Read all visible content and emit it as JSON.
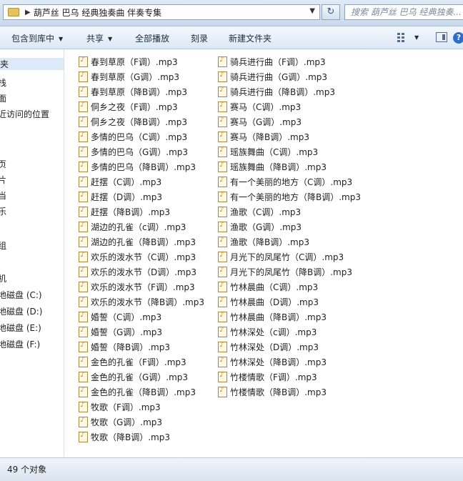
{
  "address": {
    "segments": [
      "葫芦丝 巴乌 经典独奏曲 伴奏专集"
    ],
    "search_placeholder": "搜索 葫芦丝 巴乌 经典独奏..."
  },
  "toolbar": {
    "include_library": "包含到库中",
    "share": "共享",
    "play_all": "全部播放",
    "burn": "刻录",
    "new_folder": "新建文件夹"
  },
  "nav": {
    "items": [
      "夹",
      "栈",
      "面",
      "近访问的位置",
      "",
      "页",
      "片",
      "当",
      "乐",
      "",
      "组",
      "",
      "机",
      "地磁盘 (C:)",
      "地磁盘 (D:)",
      "地磁盘 (E:)",
      "地磁盘 (F:)"
    ]
  },
  "files": {
    "col1": [
      "春到草原（F调）.mp3",
      "春到草原（G调）.mp3",
      "春到草原（降B调）.mp3",
      "侗乡之夜（F调）.mp3",
      "侗乡之夜（降B调）.mp3",
      "多情的巴乌（C调）.mp3",
      "多情的巴乌（G调）.mp3",
      "多情的巴乌（降B调）.mp3",
      "赶摆（C调）.mp3",
      "赶摆（D调）.mp3",
      "赶摆（降B调）.mp3",
      "湖边的孔雀（c调）.mp3",
      "湖边的孔雀（降B调）.mp3",
      "欢乐的泼水节（C调）.mp3",
      "欢乐的泼水节（D调）.mp3",
      "欢乐的泼水节（F调）.mp3",
      "欢乐的泼水节（降B调）.mp3",
      "婚誓（C调）.mp3",
      "婚誓（G调）.mp3",
      "婚誓（降B调）.mp3",
      "金色的孔雀（F调）.mp3",
      "金色的孔雀（G调）.mp3",
      "金色的孔雀（降B调）.mp3",
      "牧歌（F调）.mp3",
      "牧歌（G调）.mp3",
      "牧歌（降B调）.mp3"
    ],
    "col2": [
      "骑兵进行曲（F调）.mp3",
      "骑兵进行曲（G调）.mp3",
      "骑兵进行曲（降B调）.mp3",
      "赛马（C调）.mp3",
      "赛马（G调）.mp3",
      "赛马（降B调）.mp3",
      "瑶族舞曲（C调）.mp3",
      "瑶族舞曲（降B调）.mp3",
      "有一个美丽的地方（C调）.mp3",
      "有一个美丽的地方（降B调）.mp3",
      "渔歌（C调）.mp3",
      "渔歌（G调）.mp3",
      "渔歌（降B调）.mp3",
      "月光下的凤尾竹（C调）.mp3",
      "月光下的凤尾竹（降B调）.mp3",
      "竹林晨曲（C调）.mp3",
      "竹林晨曲（D调）.mp3",
      "竹林晨曲（降B调）.mp3",
      "竹林深处（c调）.mp3",
      "竹林深处（D调）.mp3",
      "竹林深处（降B调）.mp3",
      "竹楼情歌（F调）.mp3",
      "竹楼情歌（降B调）.mp3"
    ]
  },
  "status": {
    "count": "49 个对象"
  }
}
